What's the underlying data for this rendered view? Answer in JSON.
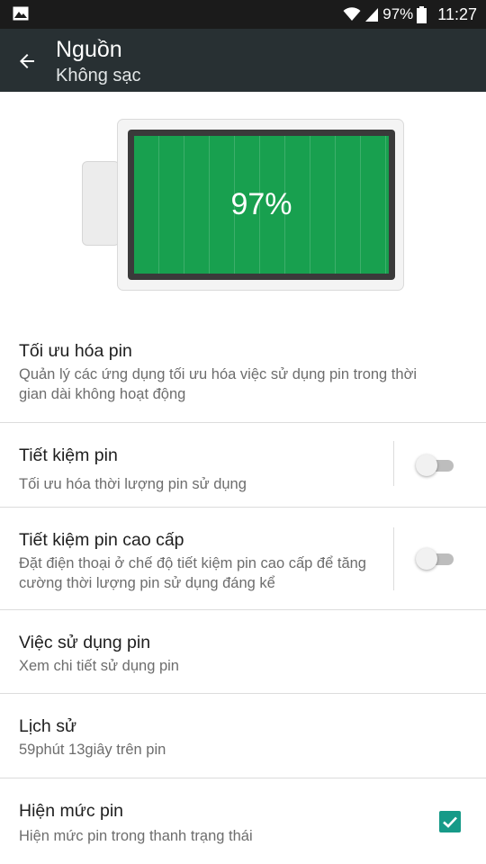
{
  "status_bar": {
    "icons": [
      "image-icon",
      "wifi-icon",
      "signal-icon",
      "battery-icon"
    ],
    "battery_percent": "97%",
    "time": "11:27"
  },
  "app_bar": {
    "back_icon": "arrow-left-icon",
    "title": "Nguồn",
    "subtitle": "Không sạc",
    "background": "#283033"
  },
  "battery": {
    "level_text": "97%",
    "level": 0.97,
    "fill_color": "#18a04f"
  },
  "settings": {
    "optimize": {
      "title": "Tối ưu hóa pin",
      "subtitle": "Quản lý các ứng dụng tối ưu hóa việc sử dụng pin trong thời gian dài không hoạt động"
    },
    "power_saver": {
      "title": "Tiết kiệm pin",
      "subtitle": "Tối ưu hóa thời lượng pin sử dụng",
      "enabled": false
    },
    "extreme_saver": {
      "title": "Tiết kiệm pin cao cấp",
      "subtitle": "Đặt điện thoại ở chế độ tiết kiệm pin cao cấp để tăng cường thời lượng pin sử dụng đáng kể",
      "enabled": false
    },
    "usage": {
      "title": "Việc sử dụng pin",
      "subtitle": "Xem chi tiết sử dụng pin"
    },
    "history": {
      "title": "Lịch sử",
      "subtitle": "59phút 13giây trên pin"
    },
    "show_level": {
      "title": "Hiện mức pin",
      "subtitle": "Hiện mức pin trong thanh trạng thái",
      "checked": true,
      "accent": "#169a88"
    }
  }
}
